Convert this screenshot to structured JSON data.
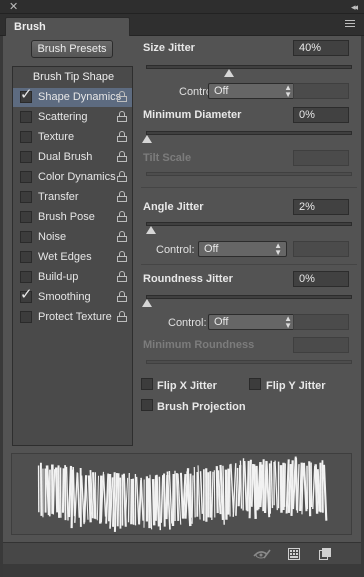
{
  "window": {
    "close_glyph": "✕",
    "collapse_glyph": "◂◂"
  },
  "tab": {
    "title": "Brush"
  },
  "presets_button": "Brush Presets",
  "list": {
    "heading": "Brush Tip Shape",
    "items": [
      {
        "label": "Shape Dynamics",
        "checked": true,
        "selected": true
      },
      {
        "label": "Scattering",
        "checked": false
      },
      {
        "label": "Texture",
        "checked": false
      },
      {
        "label": "Dual Brush",
        "checked": false
      },
      {
        "label": "Color Dynamics",
        "checked": false
      },
      {
        "label": "Transfer",
        "checked": false
      },
      {
        "label": "Brush Pose",
        "checked": false
      },
      {
        "label": "Noise",
        "checked": false
      },
      {
        "label": "Wet Edges",
        "checked": false
      },
      {
        "label": "Build-up",
        "checked": false
      },
      {
        "label": "Smoothing",
        "checked": true
      },
      {
        "label": "Protect Texture",
        "checked": false
      }
    ]
  },
  "size_jitter": {
    "label": "Size Jitter",
    "value": "40%",
    "level": 0.4
  },
  "control_1": {
    "label": "Control:",
    "value": "Off"
  },
  "minimum_diameter": {
    "label": "Minimum Diameter",
    "value": "0%",
    "level": 0
  },
  "tilt_scale": {
    "label": "Tilt Scale"
  },
  "angle_jitter": {
    "label": "Angle Jitter",
    "value": "2%",
    "level": 0.02
  },
  "control_2": {
    "label": "Control:",
    "value": "Off"
  },
  "roundness_jitter": {
    "label": "Roundness Jitter",
    "value": "0%",
    "level": 0
  },
  "control_3": {
    "label": "Control:",
    "value": "Off"
  },
  "minimum_roundness": {
    "label": "Minimum Roundness"
  },
  "checkboxes": {
    "flip_x": "Flip X Jitter",
    "flip_y": "Flip Y Jitter",
    "projection": "Brush Projection"
  },
  "colors": {
    "selection": "#5d6b80",
    "panel": "#535353"
  },
  "icons": [
    "close-icon",
    "collapse-icon",
    "panel-menu-icon",
    "lock-icon",
    "eye-brush-icon",
    "grid-icon",
    "new-preset-icon"
  ]
}
